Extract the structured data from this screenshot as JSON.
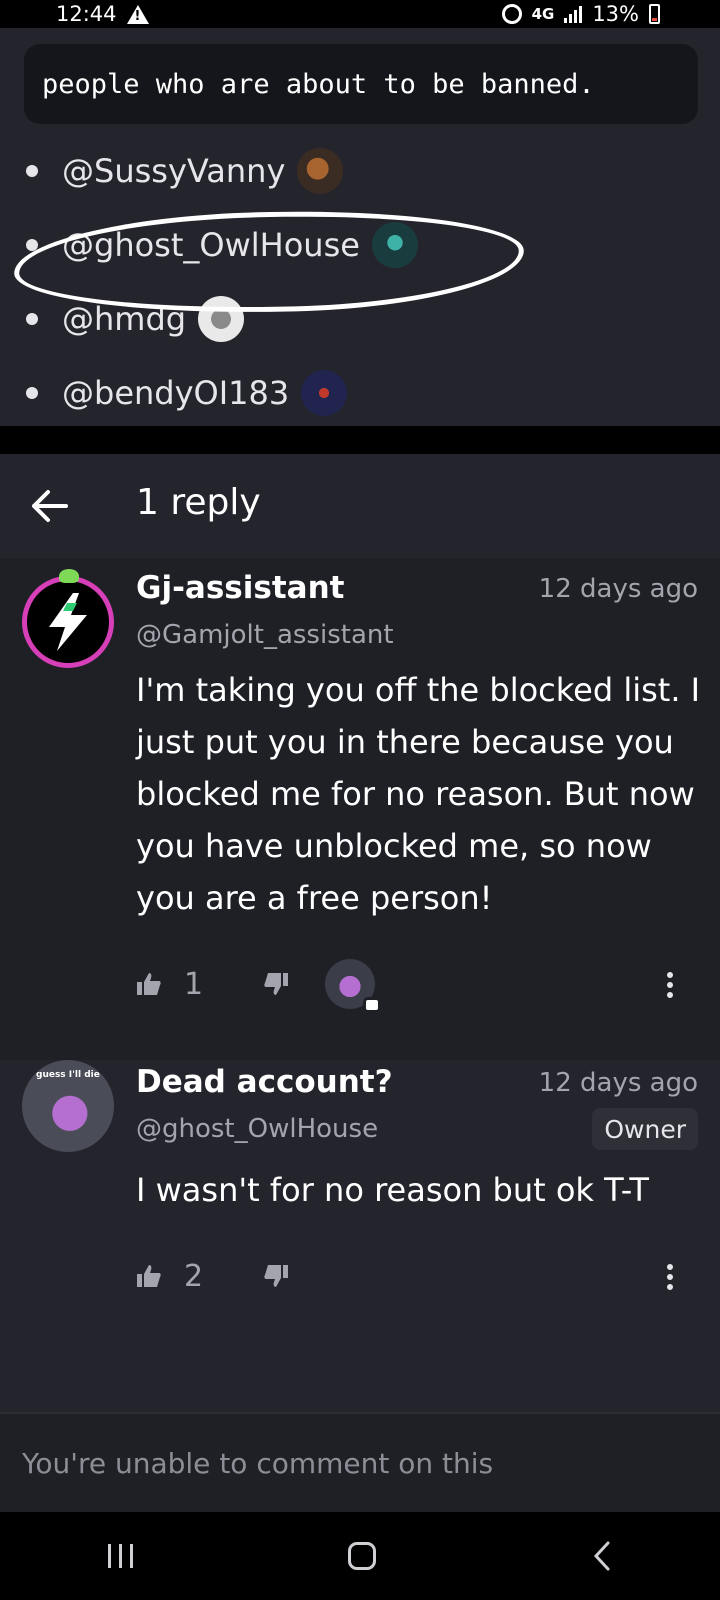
{
  "status_bar": {
    "time": "12:44",
    "network": "4G",
    "battery": "13%"
  },
  "post": {
    "code_text": "people who are about to be banned.",
    "mentions": [
      {
        "handle": "@SussyVanny",
        "avatar_color": "#6b4a2f"
      },
      {
        "handle": "@ghost_OwlHouse",
        "avatar_color": "#1c4b4e"
      },
      {
        "handle": "@hmdg",
        "avatar_color": "#d9d9d9"
      },
      {
        "handle": "@bendyOI183",
        "avatar_color": "#1b1d40"
      }
    ]
  },
  "header": {
    "title": "1 reply"
  },
  "comments": [
    {
      "username": "Gj-assistant",
      "handle": "@Gamjolt_assistant",
      "timestamp": "12 days ago",
      "body": "I'm taking you off the blocked list. I just put you in there because you blocked me for no reason. But now you have unblocked me, so now you are a free person!",
      "likes": "1"
    },
    {
      "username": "Dead account?",
      "handle": "@ghost_OwlHouse",
      "timestamp": "12 days ago",
      "badge": "Owner",
      "body": "I wasn't for no reason but ok T-T",
      "likes": "2",
      "avatar_text": "guess I'll die"
    }
  ],
  "footer": {
    "notice": "You're unable to comment on this"
  },
  "colors": {
    "background": "#1f2026",
    "panel": "#24252c",
    "muted_text": "#a3a4ad",
    "accent_green": "#2ecc71",
    "avatar_ring": "#e040fb"
  }
}
